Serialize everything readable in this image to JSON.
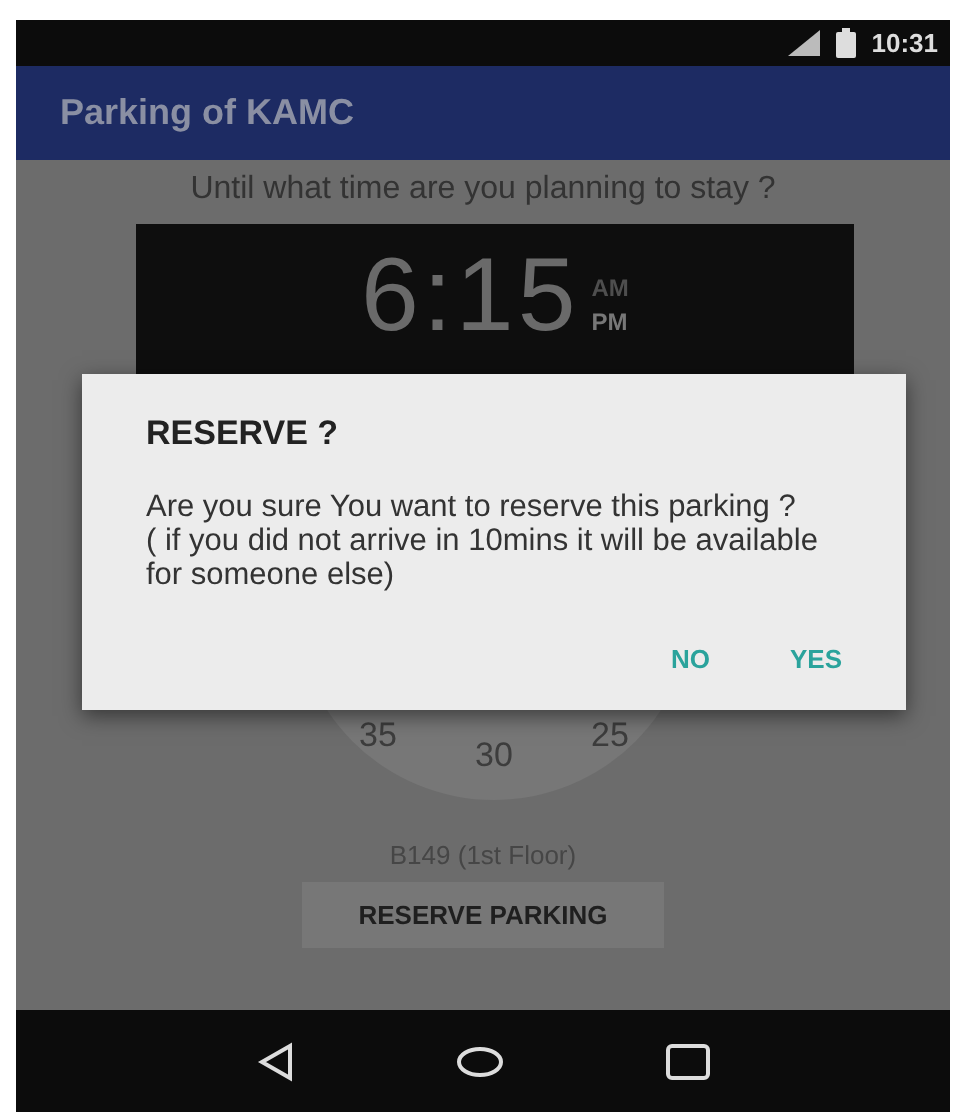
{
  "status_bar": {
    "time": "10:31"
  },
  "app_bar": {
    "title": "Parking of KAMC"
  },
  "prompt": "Until what time are you planning to stay ?",
  "time_picker": {
    "time": "6:15",
    "periods": [
      {
        "label": "AM",
        "selected": false
      },
      {
        "label": "PM",
        "selected": true
      }
    ],
    "dial_numbers": [
      "35",
      "30",
      "25"
    ]
  },
  "spot": "B149 (1st Floor)",
  "reserve_button": "RESERVE PARKING",
  "dialog": {
    "title": "RESERVE ?",
    "message": "Are you sure You want to reserve this parking ?\n ( if you did not arrive in 10mins it will be available for someone else)",
    "buttons": [
      "NO",
      "YES"
    ]
  }
}
